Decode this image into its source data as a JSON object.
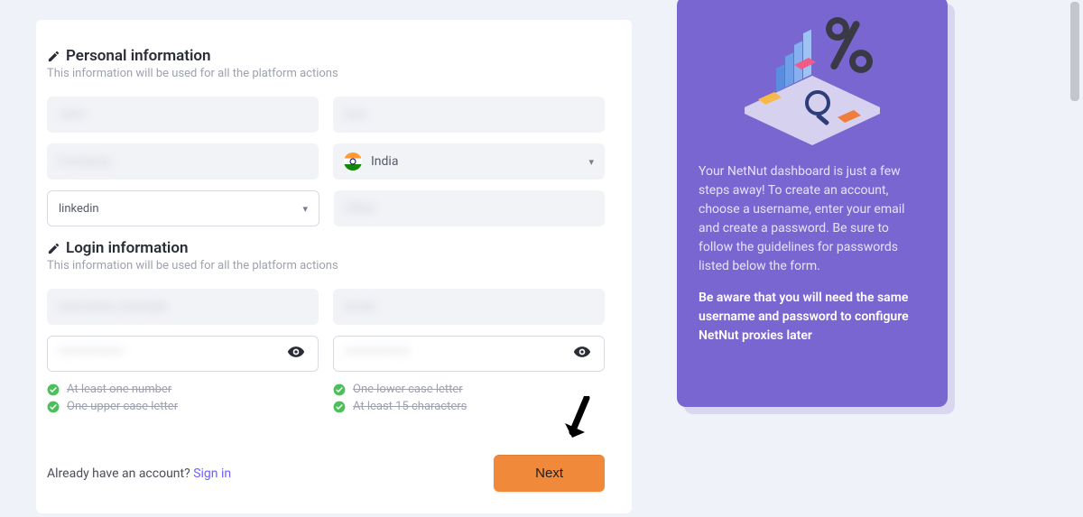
{
  "personal": {
    "title": "Personal information",
    "subtitle": "This information will be used for all the platform actions",
    "first_name": "John",
    "last_name": "Doe",
    "company": "Company",
    "country_label": "India",
    "source_select_value": "linkedin",
    "extra_field": "Other"
  },
  "login": {
    "title": "Login information",
    "subtitle": "This information will be used for all the platform actions",
    "username": "username_example",
    "email": "email",
    "password": "************",
    "confirm_password": "************"
  },
  "rules": {
    "r1": "At least one number",
    "r2": "One upper case letter",
    "r3": "One lower case letter",
    "r4": "At least 15 characters"
  },
  "footer": {
    "already_prefix": "Already have an account? ",
    "sign_in": "Sign in",
    "next_label": "Next"
  },
  "sidebar": {
    "p1": "Your NetNut dashboard is just a few steps away! To create an account, choose a username, enter your email and create a password. Be sure to follow the guidelines for passwords listed below the form.",
    "p2": "Be aware that you will need the same username and password to configure NetNut proxies later"
  }
}
